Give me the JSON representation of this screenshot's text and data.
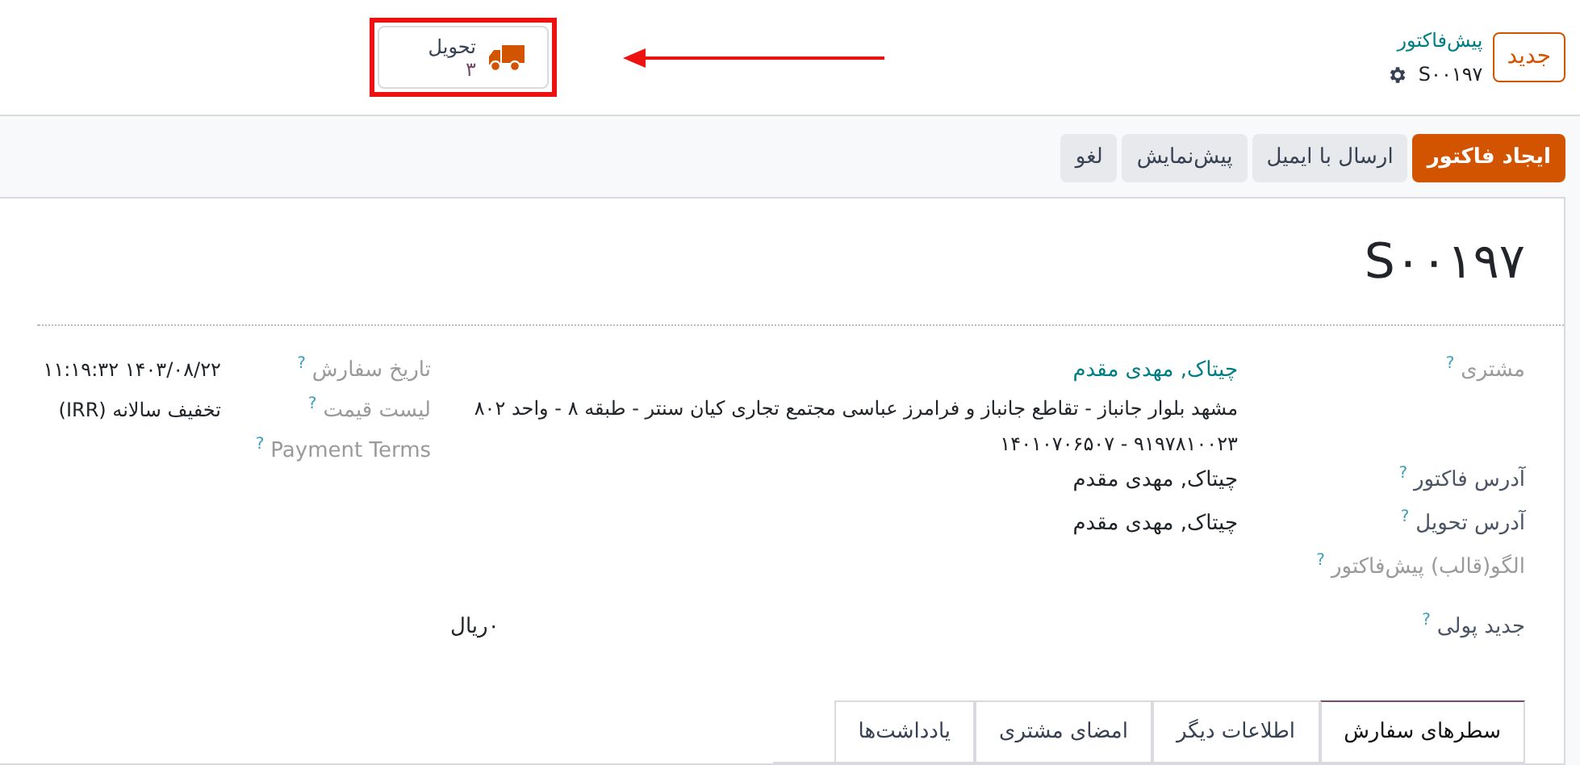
{
  "breadcrumb": {
    "new_button": "جدید",
    "parent": "پیش‌فاکتور",
    "current": "S۰۰۱۹۷"
  },
  "stat_button": {
    "label": "تحویل",
    "count": "۳",
    "highlighted": true
  },
  "annotation": {
    "arrow": true
  },
  "actions": [
    {
      "label": "ایجاد فاکتور",
      "primary": true
    },
    {
      "label": "ارسال با ایمیل",
      "primary": false
    },
    {
      "label": "پیش‌نمایش",
      "primary": false
    },
    {
      "label": "لغو",
      "primary": false
    }
  ],
  "title": "S۰۰۱۹۷",
  "main_fields": [
    {
      "label": "مشتری",
      "help": "?",
      "muted": true,
      "kind": "partner",
      "value": "چیتاک, مهدی مقدم",
      "address": "مشهد بلوار جانباز - تقاطع جانباز و فرامرز عباسی مجتمع تجاری کیان سنتر - طبقه ۸ - واحد ۸۰۲ ۹۱۹۷۸۱۰۰۲۳ - ۱۴۰۱۰۷۰۶۵۰۷"
    },
    {
      "label": "آدرس فاکتور",
      "help": "?",
      "muted": false,
      "kind": "text",
      "value": "چیتاک, مهدی مقدم"
    },
    {
      "label": "آدرس تحویل",
      "help": "?",
      "muted": false,
      "kind": "text",
      "value": "چیتاک, مهدی مقدم"
    },
    {
      "label": "الگو(قالب) پیش‌فاکتور",
      "help": "?",
      "muted": true,
      "kind": "empty"
    },
    {
      "label": "جدید پولی",
      "help": "?",
      "muted": false,
      "kind": "amount",
      "value": "۰ریال"
    }
  ],
  "side_fields": [
    {
      "label": "تاریخ سفارش",
      "help": "?",
      "muted": true,
      "value": "۱۴۰۳/۰۸/۲۲ ۱۱:۱۹:۳۲"
    },
    {
      "label": "لیست قیمت",
      "help": "?",
      "muted": true,
      "value": "تخفیف سالانه (IRR)"
    },
    {
      "label": "Payment Terms",
      "help": "?",
      "muted": true
    }
  ],
  "tabs": [
    {
      "label": "سطرهای سفارش",
      "selected": true
    },
    {
      "label": "اطلاعات دیگر",
      "selected": false
    },
    {
      "label": "امضای مشتری",
      "selected": false
    },
    {
      "label": "یادداشت‌ها",
      "selected": false
    }
  ]
}
